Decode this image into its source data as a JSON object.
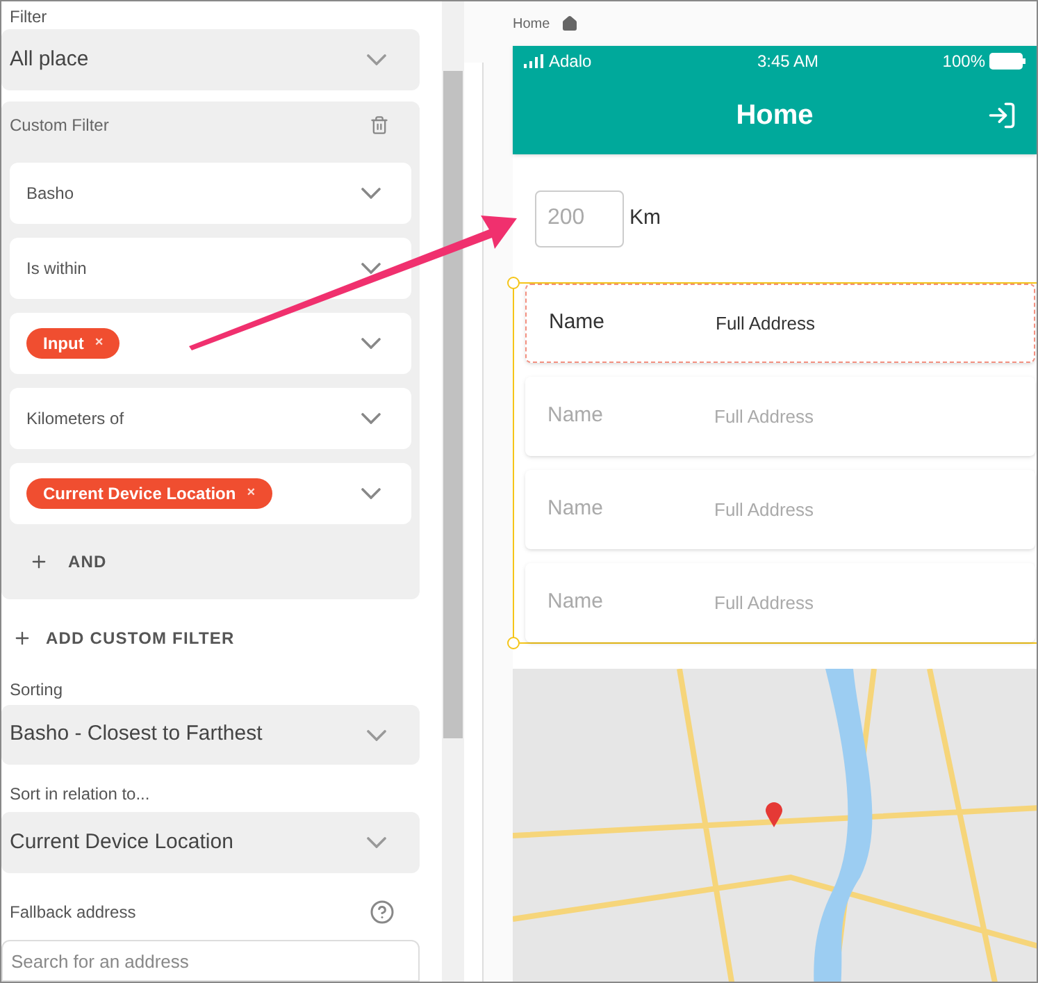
{
  "filter": {
    "label": "Filter",
    "value": "All place"
  },
  "custom_filter": {
    "title": "Custom Filter",
    "fields": [
      {
        "kind": "text",
        "value": "Basho"
      },
      {
        "kind": "text",
        "value": "Is within"
      },
      {
        "kind": "chip",
        "value": "Input",
        "remove": "×"
      },
      {
        "kind": "text",
        "value": "Kilometers of"
      },
      {
        "kind": "chip",
        "value": "Current Device Location",
        "remove": "×"
      }
    ],
    "and_button": "AND"
  },
  "add_custom_filter": "ADD CUSTOM FILTER",
  "sorting": {
    "label": "Sorting",
    "value": "Basho - Closest to Farthest"
  },
  "sort_relation": {
    "label": "Sort in relation to...",
    "value": "Current Device Location"
  },
  "fallback": {
    "label": "Fallback address",
    "placeholder": "Search for an address"
  },
  "breadcrumb": "Home",
  "phone": {
    "status_bar": {
      "carrier": "Adalo",
      "time": "3:45 AM",
      "battery": "100%"
    },
    "title": "Home",
    "distance_input": {
      "placeholder": "200",
      "unit": "Km"
    },
    "list": [
      {
        "name": "Name",
        "address": "Full Address",
        "selected": true
      },
      {
        "name": "Name",
        "address": "Full Address",
        "selected": false
      },
      {
        "name": "Name",
        "address": "Full Address",
        "selected": false
      },
      {
        "name": "Name",
        "address": "Full Address",
        "selected": false
      }
    ]
  }
}
